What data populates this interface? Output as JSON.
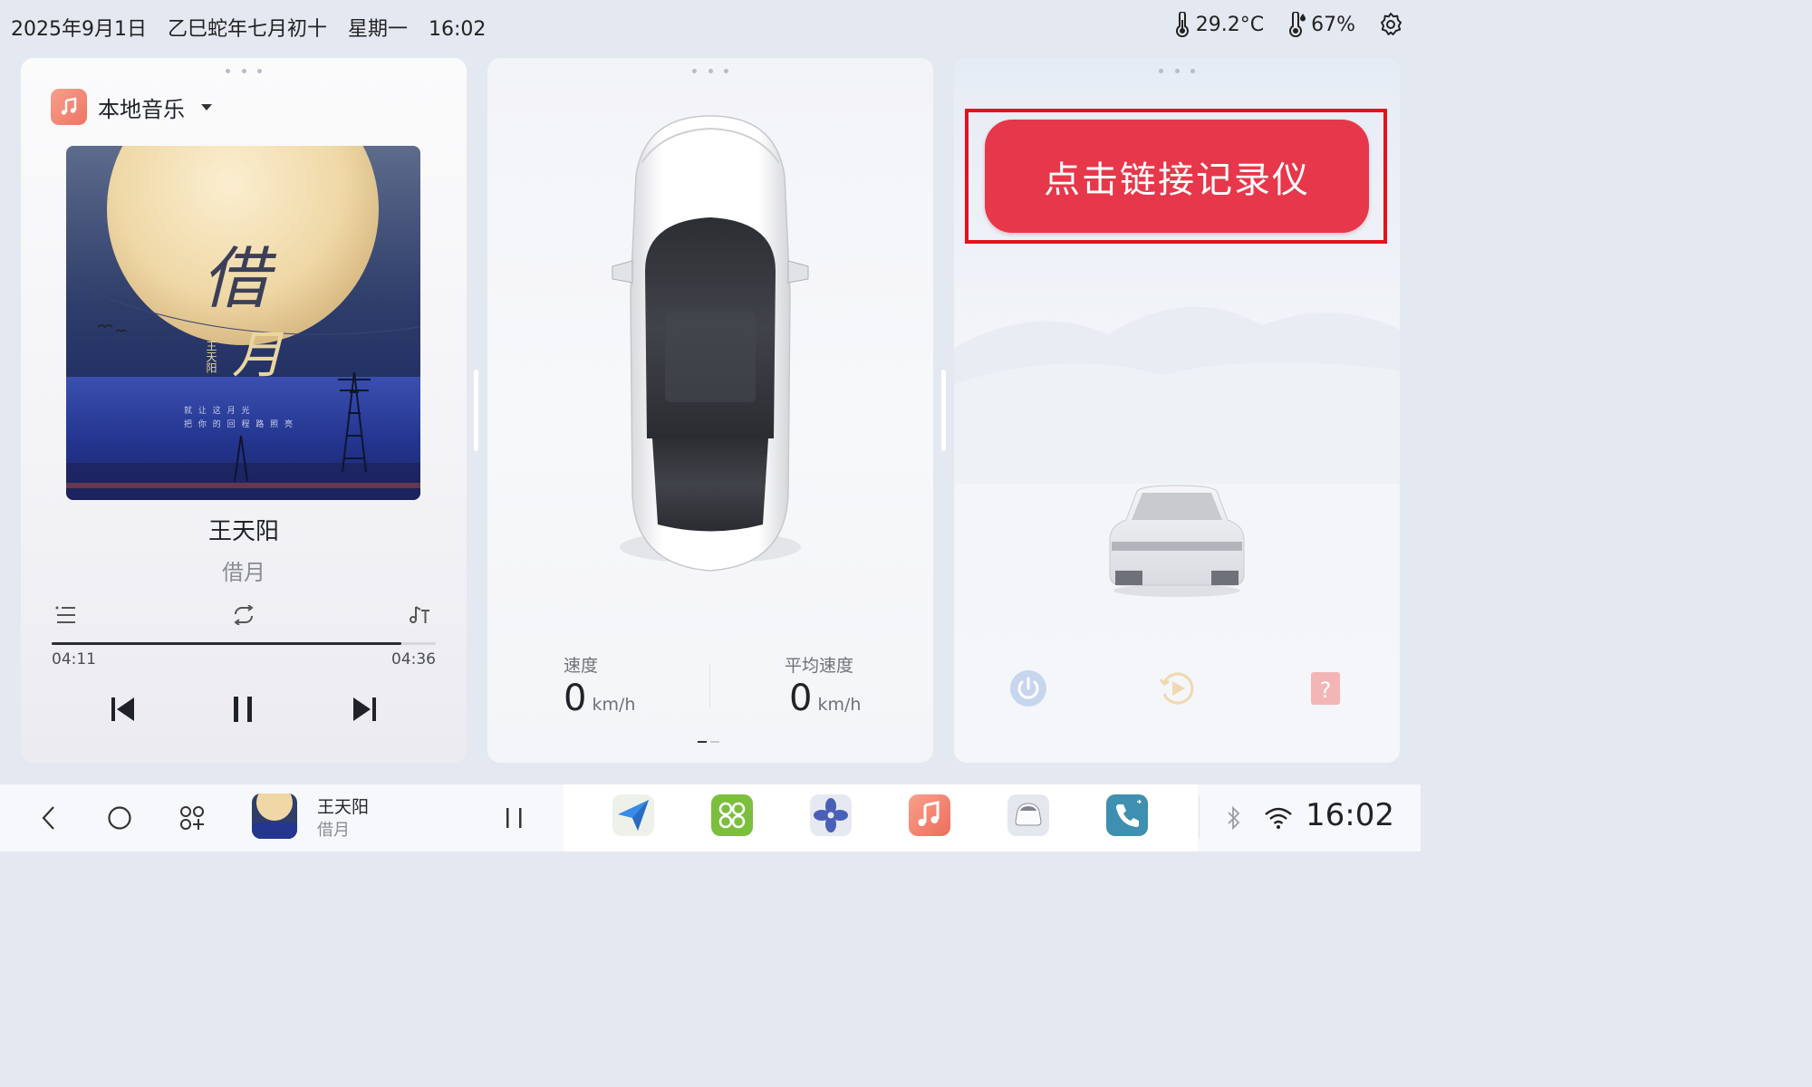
{
  "status_bar": {
    "date": "2025年9月1日",
    "lunar": "乙巳蛇年七月初十",
    "weekday": "星期一",
    "time": "16:02",
    "temperature": "29.2°C",
    "humidity": "67%",
    "icons": [
      "thermometer-icon",
      "humidity-icon",
      "settings-icon"
    ]
  },
  "music": {
    "source_label": "本地音乐",
    "artist": "王天阳",
    "title": "借月",
    "album_art_text": {
      "title_big": "借",
      "title_big2": "月",
      "artist_vertical": "王天阳",
      "lyric_line1": "就 让 这 月 光",
      "lyric_line2": "把 你 的 回 程 路 照 亮"
    },
    "elapsed": "04:11",
    "duration": "04:36",
    "progress": 0.91,
    "icons": [
      "playlist-icon",
      "repeat-icon",
      "lyrics-icon",
      "previous-icon",
      "pause-icon",
      "next-icon"
    ]
  },
  "car": {
    "speed_label": "速度",
    "speed_value": "0",
    "speed_unit": "km/h",
    "avg_speed_label": "平均速度",
    "avg_speed_value": "0",
    "avg_speed_unit": "km/h"
  },
  "dvr": {
    "connect_label": "点击链接记录仪",
    "icons": [
      "power-icon",
      "playback-icon",
      "help-icon"
    ]
  },
  "dock": {
    "artist": "王天阳",
    "title": "借月",
    "clock": "16:02",
    "apps": [
      "navigation-app-icon",
      "apps-grid-app-icon",
      "fan-app-icon",
      "music-app-icon",
      "car-app-icon",
      "phone-app-icon"
    ],
    "colors": {
      "accent_red": "#e6384a",
      "frame_red": "#e8101e"
    }
  }
}
